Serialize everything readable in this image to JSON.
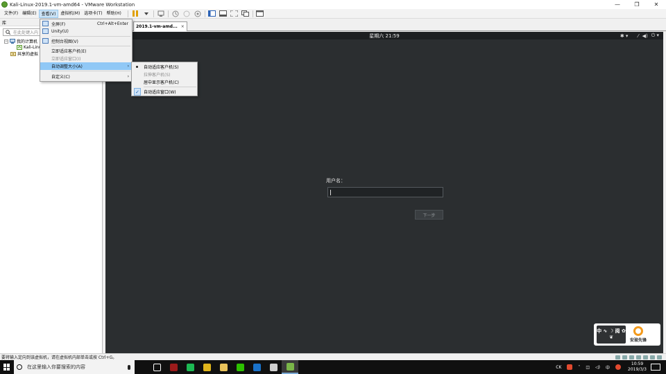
{
  "window": {
    "title": "Kali-Linux-2019.1-vm-amd64 - VMware Workstation",
    "min": "—",
    "max": "❐",
    "close": "✕"
  },
  "menubar": [
    "文件(F)",
    "编辑(E)",
    "查看(V)",
    "虚拟机(M)",
    "选项卡(T)",
    "帮助(H)"
  ],
  "library": {
    "title": "库",
    "close": "×",
    "search_placeholder": "在此处键入内",
    "tree": [
      {
        "label": "我的计算机",
        "level": 0,
        "expander": "−"
      },
      {
        "label": "Kali-Linu",
        "level": 1
      },
      {
        "label": "共享的虚拟",
        "level": 0
      }
    ]
  },
  "tab": {
    "label": "2019.1-vm-amd...",
    "close": "×"
  },
  "view_menu": {
    "items": [
      {
        "label": "全屏(F)",
        "shortcut": "Ctrl+Alt+Enter"
      },
      {
        "label": "Unity(U)"
      },
      {
        "label": "控制台视图(V)"
      },
      {
        "label": "立即适应客户机(E)"
      },
      {
        "label": "立即适应窗口(I)"
      },
      {
        "label": "自动调整大小(A)",
        "arrow": "›"
      },
      {
        "label": "自定义(C)",
        "arrow": "›"
      }
    ]
  },
  "autosize_submenu": {
    "items": [
      {
        "label": "自动适应客户机(S)"
      },
      {
        "label": "拉伸客户机(S)"
      },
      {
        "label": "居中显示客户机(C)"
      },
      {
        "label": "自动适应窗口(W)"
      }
    ]
  },
  "guest": {
    "clock": "星期六 21:59",
    "tray_icons": [
      "accessibility-icon",
      "network-icon",
      "volume-icon",
      "power-icon"
    ],
    "tray_glyphs": [
      "✱ ▾",
      "⁄",
      "◀)",
      "⏻ ▾"
    ],
    "login": {
      "username_label": "用户名：",
      "next_button": "下一步"
    }
  },
  "watermark": {
    "left_text": "中 ∿ ☽ 阅 ✿ ❦",
    "right_text": "安玻先锋"
  },
  "statusbar": {
    "message": "要将输入定向到该虚拟机，请在虚拟机内部单击或按 Ctrl+G。"
  },
  "taskbar": {
    "search_text": "在这里输入你要搜索的内容",
    "apps": [
      {
        "icon": "task-view-icon",
        "color": "#1a1a1a"
      },
      {
        "icon": "app-icon-1",
        "color": "#9b1b1b"
      },
      {
        "icon": "app-icon-2",
        "color": "#1db954"
      },
      {
        "icon": "chrome-icon",
        "color": "#e0b51c"
      },
      {
        "icon": "explorer-icon",
        "color": "#e8c25a"
      },
      {
        "icon": "wechat-icon",
        "color": "#2dc100"
      },
      {
        "icon": "app-icon-3",
        "color": "#1a72c9"
      },
      {
        "icon": "app-icon-4",
        "color": "#cfcfcf"
      },
      {
        "icon": "vmware-icon",
        "color": "#7ab648"
      }
    ],
    "tray": {
      "ck": "CK",
      "lang": "中",
      "time": "10:59",
      "date": "2019/3/3"
    }
  }
}
